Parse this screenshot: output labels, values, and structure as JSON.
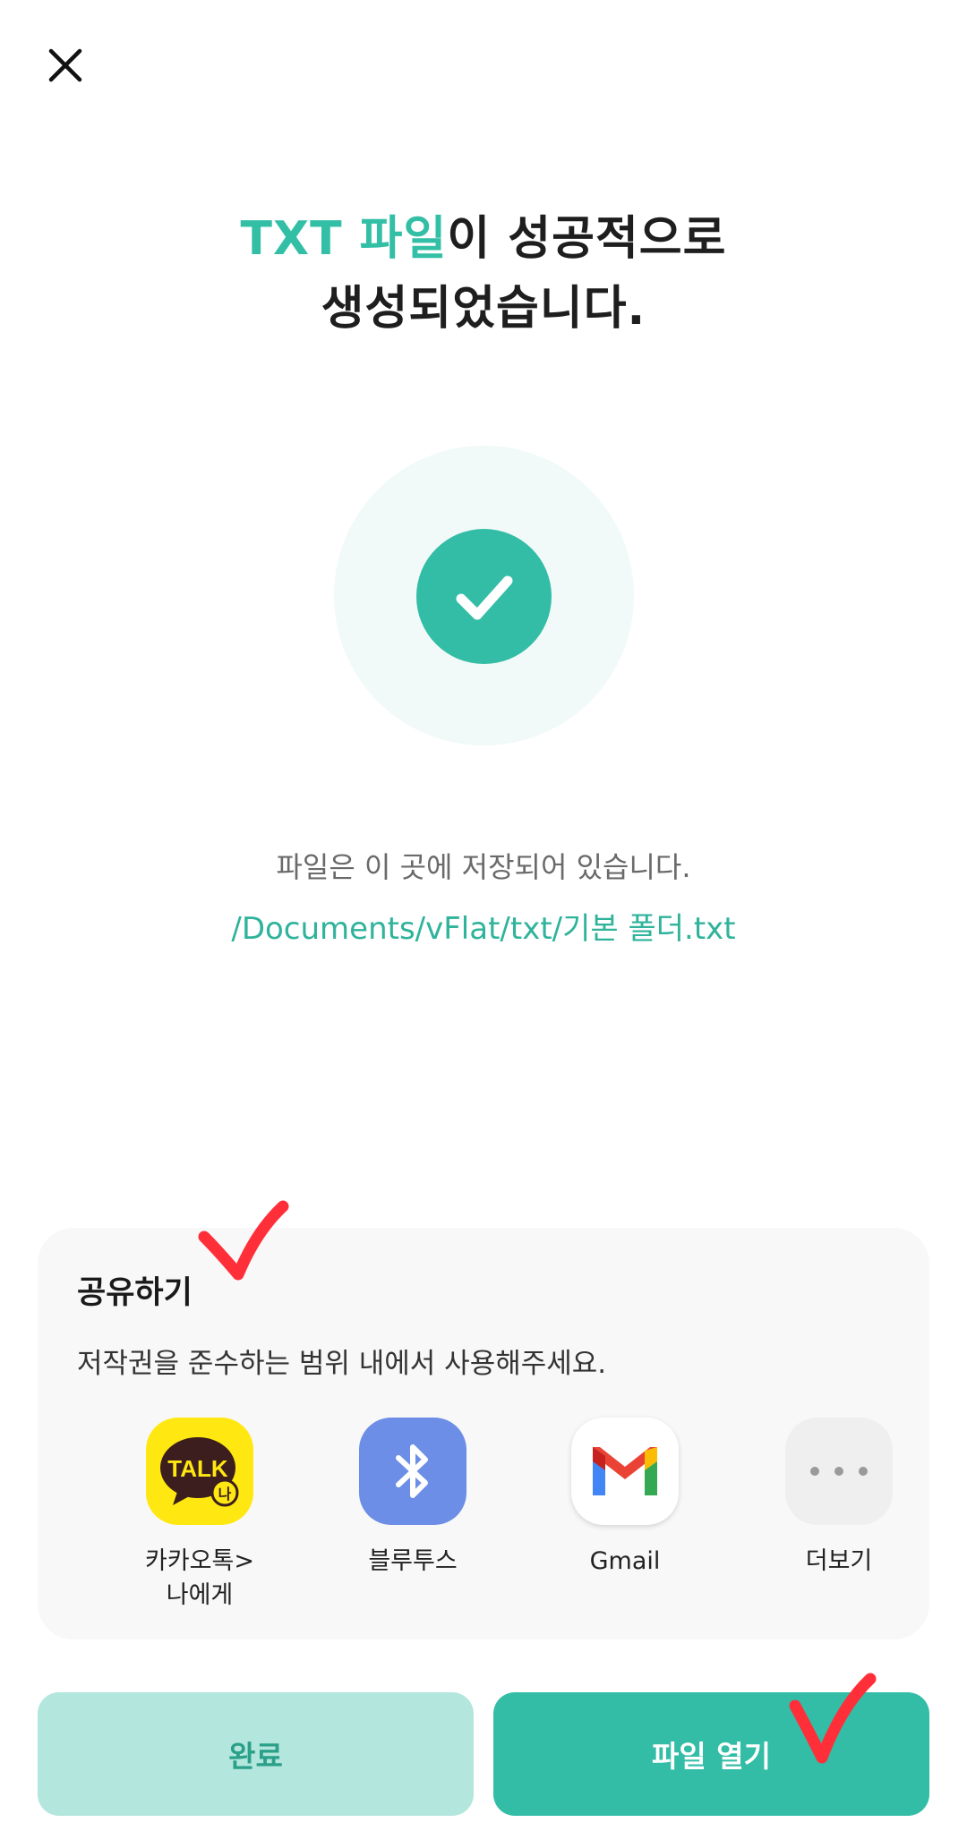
{
  "header": {
    "close_icon": "close-icon"
  },
  "title": {
    "accent": "TXT 파일",
    "rest_line1": "이 성공적으로",
    "line2": "생성되었습니다."
  },
  "status": {
    "icon": "check-icon",
    "saved_text": "파일은 이 곳에 저장되어 있습니다.",
    "path": "/Documents/vFlat/txt/기본 폴더.txt"
  },
  "share": {
    "title": "공유하기",
    "description": "저작권을 준수하는 범위 내에서 사용해주세요.",
    "apps": [
      {
        "label_line1": "카카오톡>",
        "label_line2": "나에게",
        "icon": "kakaotalk-icon",
        "icon_text": "TALK"
      },
      {
        "label_line1": "블루투스",
        "icon": "bluetooth-icon"
      },
      {
        "label_line1": "Gmail",
        "icon": "gmail-icon"
      },
      {
        "label_line1": "더보기",
        "icon": "more-icon"
      }
    ]
  },
  "buttons": {
    "done": "완료",
    "open_file": "파일 열기"
  },
  "colors": {
    "accent": "#33bda6",
    "accent_light": "#b3e6dc",
    "annotation": "#ff2f3a"
  }
}
